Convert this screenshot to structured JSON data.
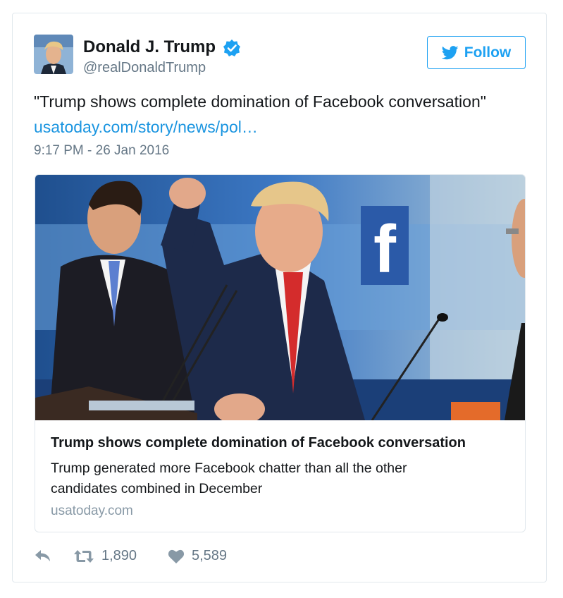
{
  "tweet": {
    "author_name": "Donald J. Trump",
    "author_handle": "@realDonaldTrump",
    "follow_label": "Follow",
    "text": "\"Trump shows complete domination of Facebook conversation\"",
    "link_text": "usatoday.com/story/news/pol…",
    "timestamp": "9:17 PM - 26 Jan 2016"
  },
  "card": {
    "title": "Trump shows complete domination of Facebook conversation",
    "description": "Trump generated more Facebook chatter than all the other candidates combined in December",
    "domain": "usatoday.com",
    "image_sign_letter": "f"
  },
  "actions": {
    "retweets": "1,890",
    "likes": "5,589"
  },
  "colors": {
    "brand_blue": "#1da1f2",
    "link_blue": "#1b95e0",
    "muted_gray": "#8899a6"
  },
  "icons": [
    "verified-icon",
    "twitter-bird-icon",
    "reply-icon",
    "retweet-icon",
    "like-icon"
  ]
}
